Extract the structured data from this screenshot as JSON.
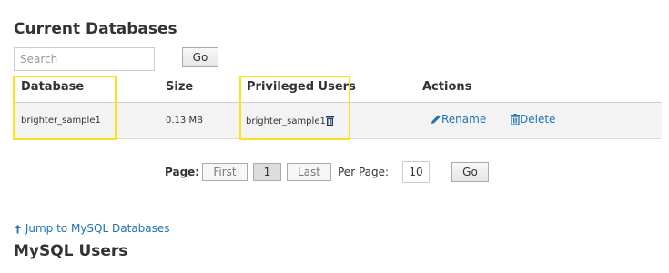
{
  "current_databases": {
    "title": "Current Databases",
    "search": {
      "placeholder": "Search",
      "value": "",
      "go_label": "Go"
    },
    "table": {
      "headers": {
        "database": "Database",
        "size": "Size",
        "privileged_users": "Privileged Users",
        "actions": "Actions"
      },
      "rows": [
        {
          "database": "brighter_sample1",
          "size": "0.13 MB",
          "privileged_user": "brighter_sample1",
          "rename_label": "Rename",
          "delete_label": "Delete"
        }
      ]
    },
    "pagination": {
      "page_label": "Page:",
      "first_label": "First",
      "current_page": "1",
      "last_label": "Last",
      "per_page_label": "Per Page:",
      "per_page_value": "10",
      "go_label": "Go"
    }
  },
  "jump_link": {
    "label": "Jump to MySQL Databases",
    "icon": "arrow-up-icon"
  },
  "mysql_users": {
    "title": "MySQL Users"
  },
  "colors": {
    "link": "#1f72b4",
    "highlight": "#ffe11b",
    "row_bg": "#f3f3f3"
  }
}
